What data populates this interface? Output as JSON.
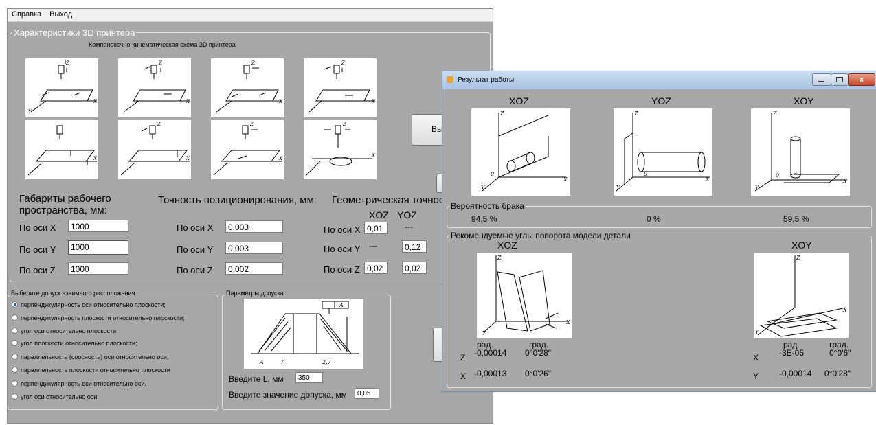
{
  "main_window": {
    "menu": [
      "Справка",
      "Выход"
    ],
    "group_characteristics": "Характеристики 3D принтера",
    "scheme_caption": "Компоновочно-кинематическая схема 3D принтера",
    "scheme_count": 8,
    "button_partial_label": "Вы",
    "workspace": {
      "title_line1": "Габариты рабочего",
      "title_line2": "пространства, мм:",
      "x_label": "По оси X",
      "x_value": "1000",
      "y_label": "По оси Y",
      "y_value": "1000",
      "z_label": "По оси Z",
      "z_value": "1000"
    },
    "positioning": {
      "title": "Точность позиционирования, мм:",
      "x_label": "По оси X",
      "x_value": "0,003",
      "y_label": "По оси Y",
      "y_value": "0,003",
      "z_label": "По оси Z",
      "z_value": "0,002"
    },
    "geometric": {
      "title": "Геометрическая точнос",
      "col_xoz": "XOZ",
      "col_yoz": "YOZ",
      "x_label": "По оси X",
      "x_xoz": "0,01",
      "x_yoz": "---",
      "y_label": "По оси Y",
      "y_xoz": "---",
      "y_yoz": "0,12",
      "z_label": "По оси Z",
      "z_xoz": "0,02",
      "z_yoz": "0,02"
    },
    "tolerance_group": {
      "title": "Выберите допуск взаимного расположения",
      "options": [
        "перпендикулярность оси относительно плоскости;",
        "перпендикулярность плоскости относительно плоскости;",
        "угол оси относительно плоскости;",
        "угол плоскости относительно плоскости;",
        "параллельность (соосность) оси относительно оси;",
        "параллельность плоскости относительно плоскости",
        "перпендикулярность оси относительно оси.",
        "угол оси относительно оси."
      ],
      "selected_index": 0
    },
    "params_group": {
      "title": "Параметры допуска",
      "L_label": "Введите L, мм",
      "L_value": "350",
      "tol_label": "Введите значение допуска, мм",
      "tol_value": "0,05",
      "drawing_labels": {
        "frame": "A",
        "base": "A",
        "left": "7",
        "right": "2,7"
      }
    }
  },
  "result_window": {
    "title": "Результат работы",
    "views": [
      "XOZ",
      "YOZ",
      "XOY"
    ],
    "defect_group": "Вероятность брака",
    "defect_values": [
      "94,5 %",
      "0 %",
      "59,5 %"
    ],
    "angles_group": "Рекомендуемые углы поворота модели детали",
    "left": {
      "view": "XOZ",
      "col_rad": "рад.",
      "col_deg": "град.",
      "rows": [
        {
          "axis": "Z",
          "rad": "-0,00014",
          "deg": "0°0'28\""
        },
        {
          "axis": "X",
          "rad": "-0,00013",
          "deg": "0°0'26\""
        }
      ]
    },
    "right": {
      "view": "XOY",
      "col_rad": "рад.",
      "col_deg": "град.",
      "rows": [
        {
          "axis": "X",
          "rad": "-3E-05",
          "deg": "0°0'6\""
        },
        {
          "axis": "Y",
          "rad": "-0,00014",
          "deg": "0°0'28\""
        }
      ]
    },
    "axis_labels": {
      "x": "X",
      "y": "Y",
      "z": "Z",
      "origin": "0"
    }
  }
}
